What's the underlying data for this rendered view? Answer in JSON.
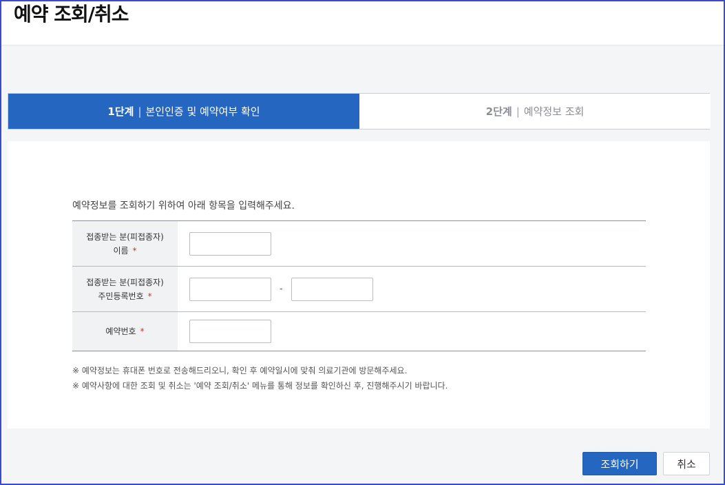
{
  "page": {
    "title": "예약 조회/취소"
  },
  "steps": [
    {
      "num": "1단계",
      "sep": "|",
      "label": "본인인증 및 예약여부 확인",
      "active": true
    },
    {
      "num": "2단계",
      "sep": "|",
      "label": "예약정보 조회",
      "active": false
    }
  ],
  "form": {
    "intro": "예약정보를 조회하기 위하여 아래 항목을 입력해주세요.",
    "rows": [
      {
        "label_line1": "접종받는 분(피접종자)",
        "label_line2": "이름",
        "required": "*"
      },
      {
        "label_line1": "접종받는 분(피접종자)",
        "label_line2": "주민등록번호",
        "required": "*",
        "separator": "-"
      },
      {
        "label_line1": "",
        "label_line2": "예약번호",
        "required": "*"
      }
    ],
    "values": {
      "name": "",
      "rrn_front": "",
      "rrn_back": "",
      "reservation_no": ""
    }
  },
  "notes": [
    "※ 예약정보는 휴대폰 번호로 전송해드리오니, 확인 후 예약일시에 맞춰 의료기관에 방문해주세요.",
    "※ 예약사항에 대한 조회 및 취소는 '예약 조회/취소' 메뉴를 통해 정보를 확인하신 후, 진행해주시기 바랍니다."
  ],
  "buttons": {
    "search": "조회하기",
    "cancel": "취소"
  },
  "colors": {
    "accent": "#2566c0",
    "required": "#d9302c",
    "frame": "#3b4bd0"
  }
}
